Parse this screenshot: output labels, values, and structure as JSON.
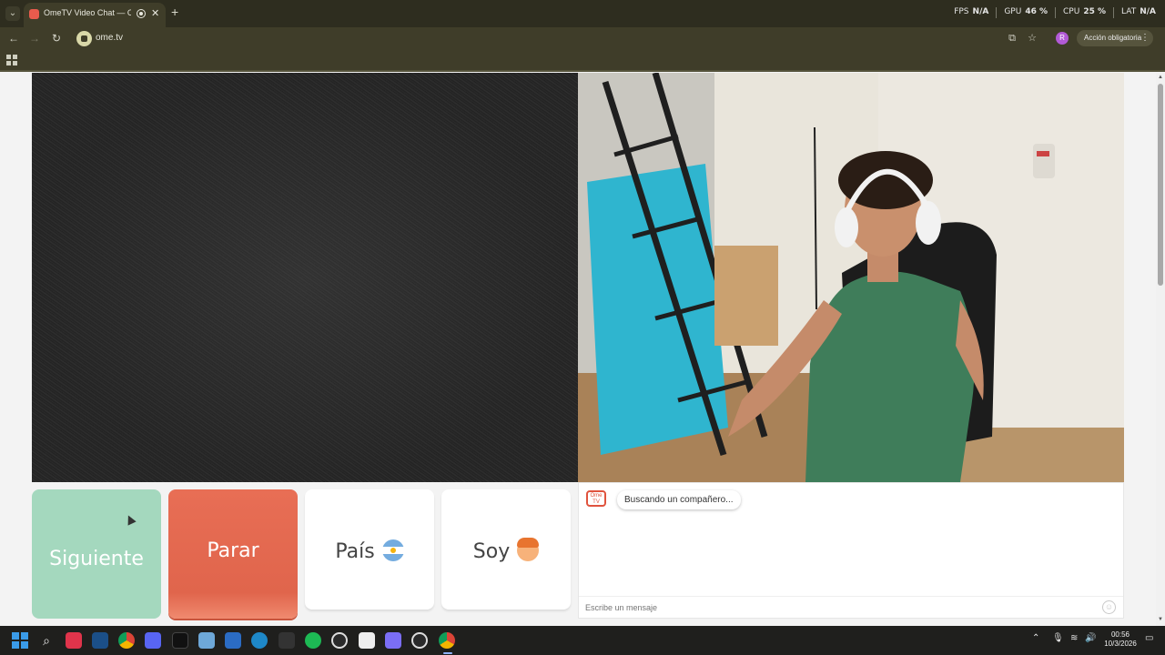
{
  "browser": {
    "tab_title": "OmeTV Video Chat — Ome",
    "url": "ome.tv",
    "profile_initial": "R",
    "accion_label": "Acción obligatoria",
    "new_tab_symbol": "+",
    "close_symbol": "✕"
  },
  "perf_overlay": [
    {
      "label": "FPS",
      "value": "N/A"
    },
    {
      "label": "GPU",
      "value": "46 %"
    },
    {
      "label": "CPU",
      "value": "25 %"
    },
    {
      "label": "LAT",
      "value": "N/A"
    }
  ],
  "controls": {
    "next_label": "Siguiente",
    "stop_label": "Parar",
    "country_label": "País",
    "gender_label": "Soy"
  },
  "chat": {
    "logo_text": "Ome TV",
    "status": "Buscando un compañero...",
    "input_placeholder": "Escribe un mensaje"
  },
  "taskbar": {
    "apps": [
      "windows-start",
      "search",
      "tiktok-studio",
      "steam",
      "chrome",
      "discord",
      "tiktok",
      "app-bluestacks",
      "malwarebytes",
      "edge",
      "dolby",
      "spotify",
      "chatgpt",
      "epic-games",
      "xbox",
      "obs",
      "chrome-profile"
    ],
    "time": "00:56",
    "date": "10/3/2026"
  },
  "colors": {
    "next": "#a4d8be",
    "stop": "#e0654c",
    "chrome": "#3f3d29"
  }
}
